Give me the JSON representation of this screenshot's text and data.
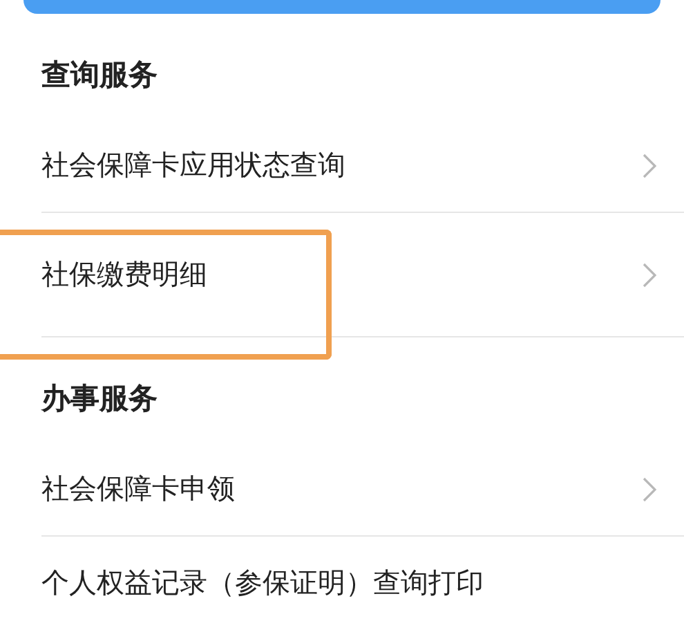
{
  "sections": [
    {
      "title": "查询服务",
      "items": [
        {
          "label": "社会保障卡应用状态查询",
          "highlighted": false
        },
        {
          "label": "社保缴费明细",
          "highlighted": true
        }
      ]
    },
    {
      "title": "办事服务",
      "items": [
        {
          "label": "社会保障卡申领",
          "highlighted": false
        },
        {
          "label": "个人权益记录（参保证明）查询打印",
          "highlighted": false
        }
      ]
    }
  ]
}
